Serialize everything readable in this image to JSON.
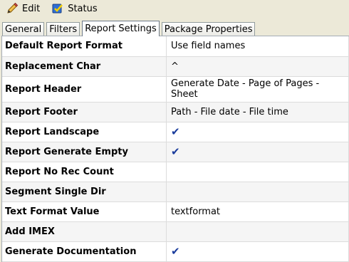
{
  "toolbar": {
    "edit_label": "Edit",
    "status_label": "Status",
    "edit_icon": "pencil-icon",
    "status_icon": "status-icon"
  },
  "tabs": [
    {
      "label": "General",
      "active": false
    },
    {
      "label": "Filters",
      "active": false
    },
    {
      "label": "Report Settings",
      "active": true
    },
    {
      "label": "Package Properties",
      "active": false
    }
  ],
  "rows": [
    {
      "key": "Default Report Format",
      "value": "Use field names",
      "check": false
    },
    {
      "key": "Replacement Char",
      "value": "^",
      "check": false
    },
    {
      "key": "Report Header",
      "value": "Generate Date - Page of Pages - Sheet",
      "check": false
    },
    {
      "key": "Report Footer",
      "value": "Path - File date - File time",
      "check": false
    },
    {
      "key": "Report Landscape",
      "value": "",
      "check": true
    },
    {
      "key": "Report Generate Empty",
      "value": "",
      "check": true
    },
    {
      "key": "Report No Rec Count",
      "value": "",
      "check": false
    },
    {
      "key": "Segment Single Dir",
      "value": "",
      "check": false
    },
    {
      "key": "Text Format Value",
      "value": "textformat",
      "check": false
    },
    {
      "key": "Add IMEX",
      "value": "",
      "check": false
    },
    {
      "key": "Generate Documentation",
      "value": "",
      "check": true
    }
  ],
  "check_glyph": "✔",
  "colors": {
    "check": "#1a3c9c",
    "background": "#ece9d8"
  }
}
